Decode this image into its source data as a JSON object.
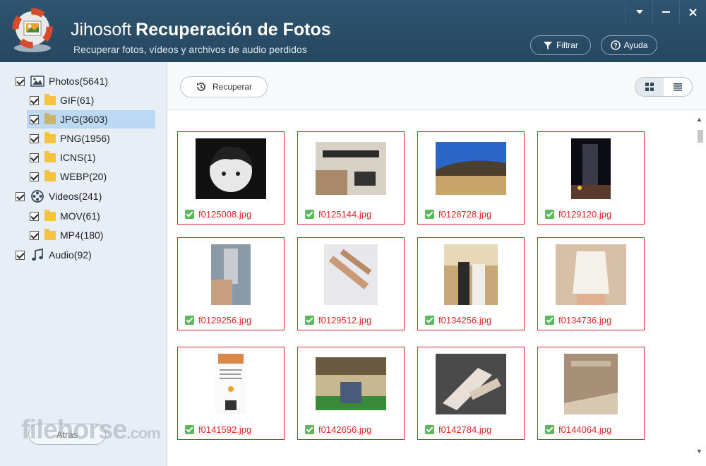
{
  "app": {
    "brand": "Jihosoft",
    "product": "Recuperación de Fotos",
    "subtitle": "Recuperar fotos, vídeos y archivos de audio perdidos"
  },
  "header_buttons": {
    "filter": "Filtrar",
    "help": "Ayuda"
  },
  "window_controls": [
    "dropdown-icon",
    "minimize-icon",
    "close-icon"
  ],
  "sidebar": {
    "items": [
      {
        "label": "Photos(5641)",
        "level": 0,
        "icon": "image-icon"
      },
      {
        "label": "GIF(61)",
        "level": 1,
        "icon": "folder-icon"
      },
      {
        "label": "JPG(3603)",
        "level": 1,
        "icon": "folder-icon",
        "selected": true
      },
      {
        "label": "PNG(1956)",
        "level": 1,
        "icon": "folder-icon"
      },
      {
        "label": "ICNS(1)",
        "level": 1,
        "icon": "folder-icon"
      },
      {
        "label": "WEBP(20)",
        "level": 1,
        "icon": "folder-icon"
      },
      {
        "label": "Videos(241)",
        "level": 0,
        "icon": "film-reel-icon"
      },
      {
        "label": "MOV(61)",
        "level": 1,
        "icon": "folder-icon"
      },
      {
        "label": "MP4(180)",
        "level": 1,
        "icon": "folder-icon"
      },
      {
        "label": "Audio(92)",
        "level": 0,
        "icon": "music-note-icon"
      }
    ]
  },
  "toolbar": {
    "recover_label": "Recuperar"
  },
  "files": [
    "f0125008.jpg",
    "f0125144.jpg",
    "f0128728.jpg",
    "f0129120.jpg",
    "f0129256.jpg",
    "f0129512.jpg",
    "f0134256.jpg",
    "f0134736.jpg",
    "f0141592.jpg",
    "f0142656.jpg",
    "f0142784.jpg",
    "f0144064.jpg"
  ],
  "footer": {
    "back_label": "Atrás",
    "watermark": "filehorse",
    "watermark_suffix": ".com"
  },
  "colors": {
    "header": "#2a4a64",
    "accent_red": "#d9262b",
    "selected": "#bcd9f3",
    "check_green": "#5cb85c"
  }
}
